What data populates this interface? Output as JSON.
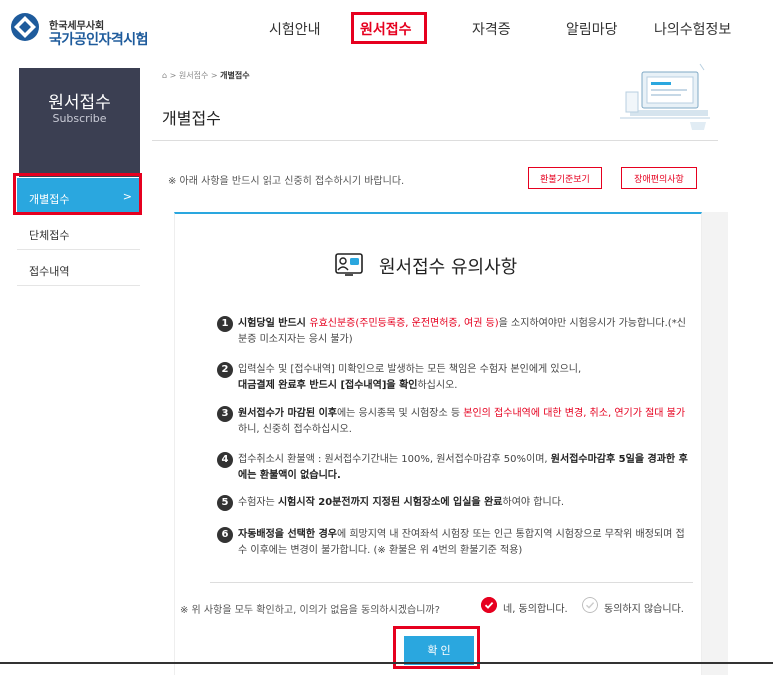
{
  "header": {
    "logo_small": "한국세무사회",
    "logo_big": "국가공인자격시험",
    "nav": [
      {
        "label": "시험안내"
      },
      {
        "label": "원서접수"
      },
      {
        "label": "자격증"
      },
      {
        "label": "알림마당"
      },
      {
        "label": "나의수험정보"
      }
    ]
  },
  "sidebar": {
    "title": "원서접수",
    "subtitle": "Subscribe",
    "items": [
      {
        "label": "개별접수",
        "arrow": ">"
      },
      {
        "label": "단체접수"
      },
      {
        "label": "접수내역"
      }
    ]
  },
  "breadcrumb": {
    "home_icon": "home-icon",
    "sep": ">",
    "level1": "원서접수",
    "current": "개별접수"
  },
  "page_title": "개별접수",
  "notice_text": "※ 아래 사항을 반드시 읽고 신중히 접수하시기 바랍니다.",
  "buttons": {
    "refund": "환불기준보기",
    "disability": "장애편의사항",
    "confirm": "확 인"
  },
  "panel": {
    "heading": "원서접수 유의사항",
    "heading_icon": "notice-board-icon",
    "items": [
      {
        "num": "1",
        "parts": {
          "a": "시험당일 반드시 ",
          "b": "유효신분증(주민등록증, 운전면허증, 여권 등)",
          "c": "을 소지하여야만 시험응시가 가능합니다.(*신분증 미소지자는 응시 불가)"
        }
      },
      {
        "num": "2",
        "parts": {
          "a": "입력실수 및 [접수내역] 미확인으로 발생하는 모든 책임은 수험자 본인에게 있으니,",
          "b": "대금결제 완료후 반드시 [접수내역]을 확인",
          "c": "하십시오."
        }
      },
      {
        "num": "3",
        "parts": {
          "a": "원서접수가 마감된 이후",
          "b": "에는 응시종목 및 시험장소 등 ",
          "c": "본인의 접수내역에 대한 변경, 취소, 연기가 절대 불가",
          "d": "하니, 신중히 접수하십시오."
        }
      },
      {
        "num": "4",
        "parts": {
          "a": "접수취소시 환불액 : 원서접수기간내는 100%, 원서접수마감후 50%이며, ",
          "b": "원서접수마감후 5일을 경과한 후에는 환불액이 없습니다."
        }
      },
      {
        "num": "5",
        "parts": {
          "a": "수험자는 ",
          "b": "시험시작 20분전까지 지정된 시험장소에 입실을 완료",
          "c": "하여야 합니다."
        }
      },
      {
        "num": "6",
        "parts": {
          "a": "자동배정을 선택한 경우",
          "b": "에 희망지역 내 잔여좌석 시험장 또는 인근 통합지역 시험장으로 무작위 배정되며 접수 이후에는 변경이 불가합니다. (※ 환불은 위 4번의 환불기준 적용)"
        }
      }
    ]
  },
  "agree": {
    "question": "※ 위 사항을 모두 확인하고, 이의가 없음을 동의하시겠습니까?",
    "yes": "네, 동의합니다.",
    "no": "동의하지 않습니다."
  },
  "colors": {
    "accent": "#2aa7df",
    "highlight": "#e6001f",
    "sidebar_bg": "#3b3f52",
    "logo_blue": "#1e5b9c"
  }
}
